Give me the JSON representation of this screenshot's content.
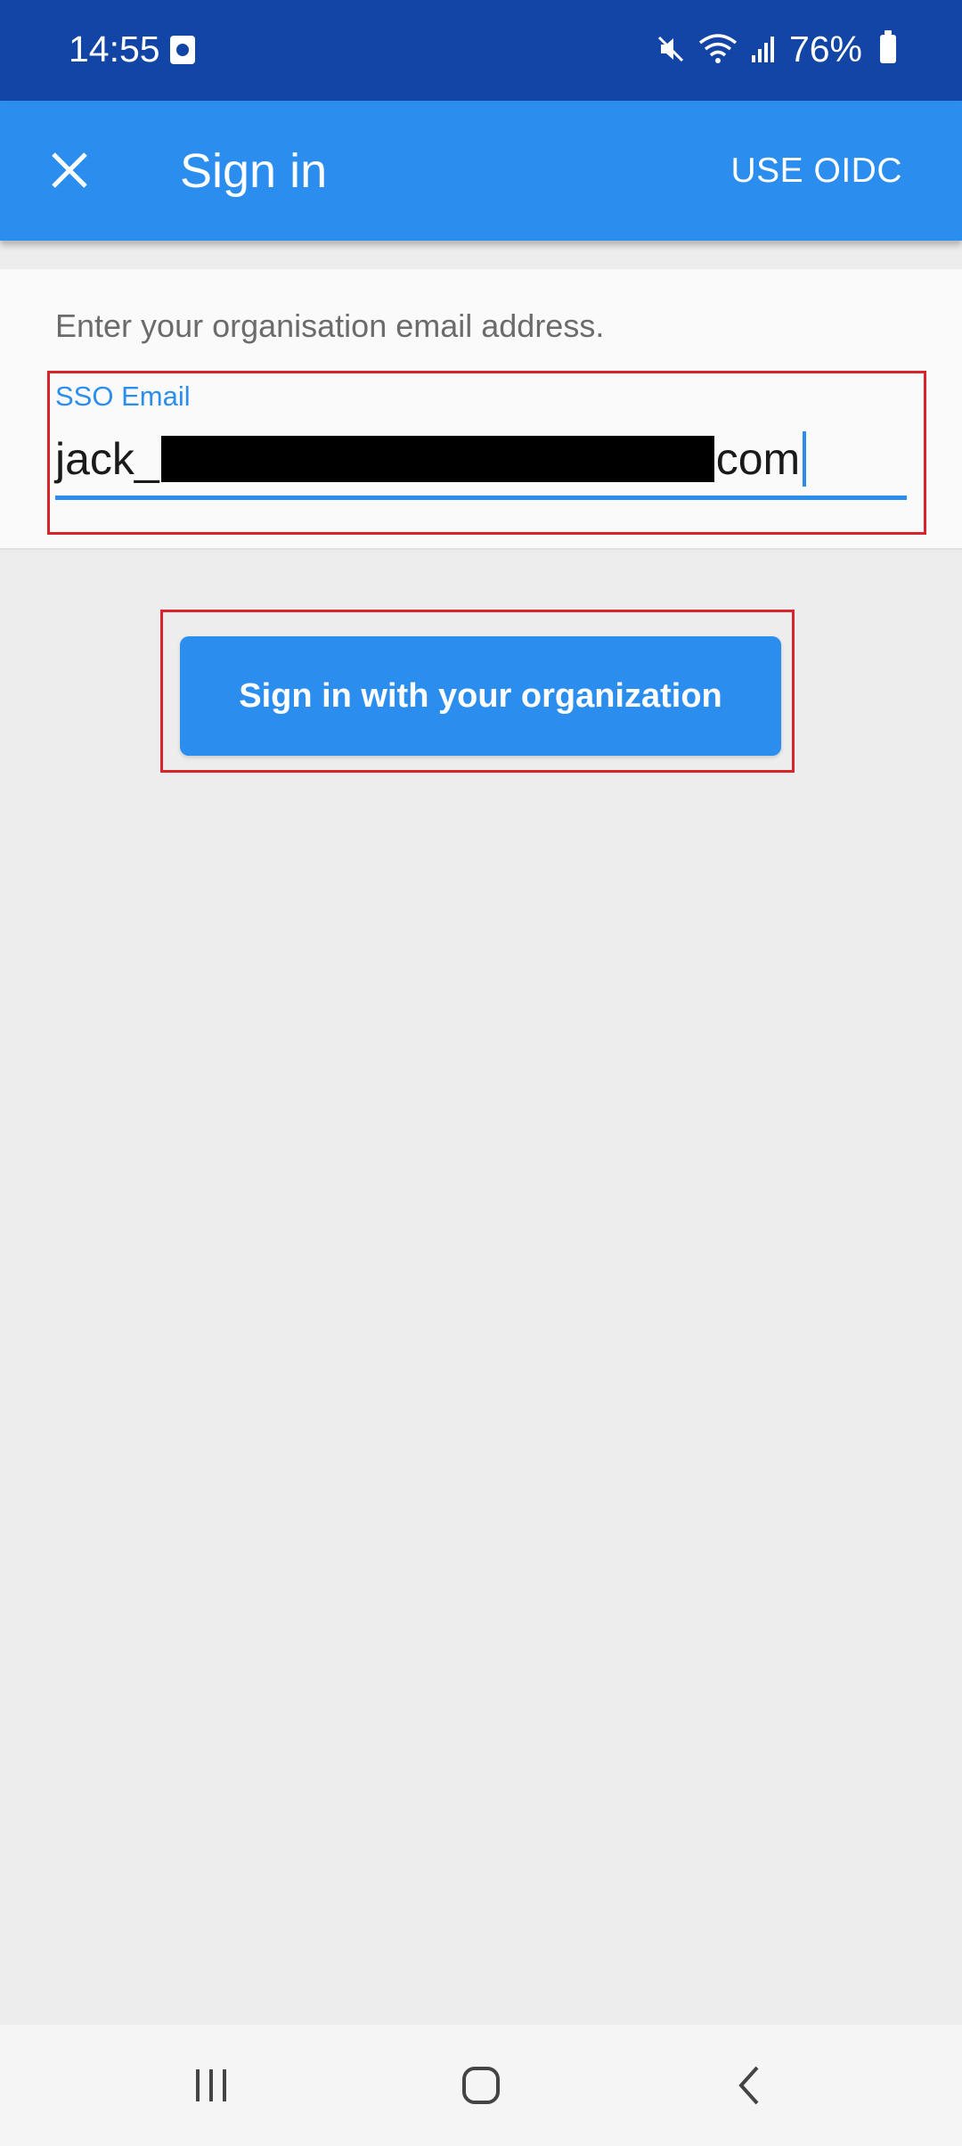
{
  "status_bar": {
    "time": "14:55",
    "battery_percent": "76%",
    "icons": [
      "app-notification-icon",
      "mute-icon",
      "wifi-icon",
      "signal-icon",
      "battery-icon"
    ]
  },
  "app_bar": {
    "title": "Sign in",
    "close_icon": "close-icon",
    "action_label": "USE OIDC"
  },
  "form": {
    "instruction": "Enter your organisation email address.",
    "email_label": "SSO Email",
    "email_value_prefix": "jack_",
    "email_value_suffix": "com",
    "redacted": true
  },
  "primary_button": {
    "label": "Sign in with your organization"
  },
  "nav_bar": {
    "icons": [
      "recent-apps-icon",
      "home-icon",
      "back-icon"
    ]
  },
  "colors": {
    "status_bar": "#1245a5",
    "app_bar": "#2b8eef",
    "accent": "#2b8eef",
    "highlight": "#d9242e",
    "background": "#ededed"
  }
}
